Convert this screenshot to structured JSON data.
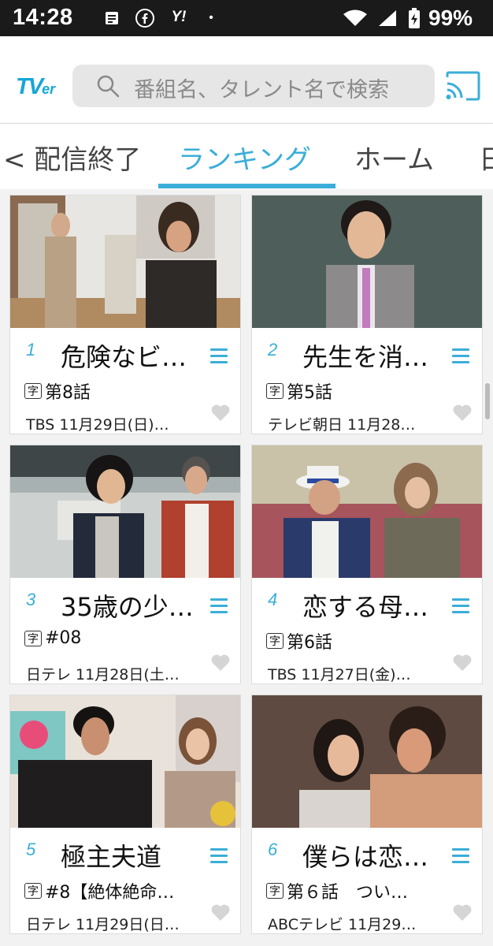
{
  "status_bar": {
    "time": "14:28",
    "yahoo": "Y!",
    "dot": "•",
    "battery_pct": "99%"
  },
  "header": {
    "logo_main": "TV",
    "logo_sub": "er",
    "search_placeholder": "番組名、タレント名で検索",
    "brand_color": "#15a7d6"
  },
  "tabs": {
    "items": [
      {
        "label": "< 配信終了"
      },
      {
        "label": "ランキング"
      },
      {
        "label": "ホーム"
      },
      {
        "label": "日"
      }
    ],
    "active_color": "#3aaed8"
  },
  "rankings": [
    {
      "rank": "1",
      "title": "危険なビ…",
      "episode": "第8話",
      "meta": "TBS 11月29日(日)…"
    },
    {
      "rank": "2",
      "title": "先生を消…",
      "episode": "第5話",
      "meta": "テレビ朝日 11月28…"
    },
    {
      "rank": "3",
      "title": "35歳の少…",
      "episode": "#08",
      "meta": "日テレ 11月28日(土…"
    },
    {
      "rank": "4",
      "title": "恋する母…",
      "episode": "第6話",
      "meta": "TBS 11月27日(金)…"
    },
    {
      "rank": "5",
      "title": "極主夫道",
      "episode": "#8【絶体絶命…",
      "meta": "日テレ 11月29日(日…"
    },
    {
      "rank": "6",
      "title": "僕らは恋…",
      "episode": "第６話　つい…",
      "meta": "ABCテレビ 11月29…"
    }
  ],
  "subtitle_badge": "字"
}
